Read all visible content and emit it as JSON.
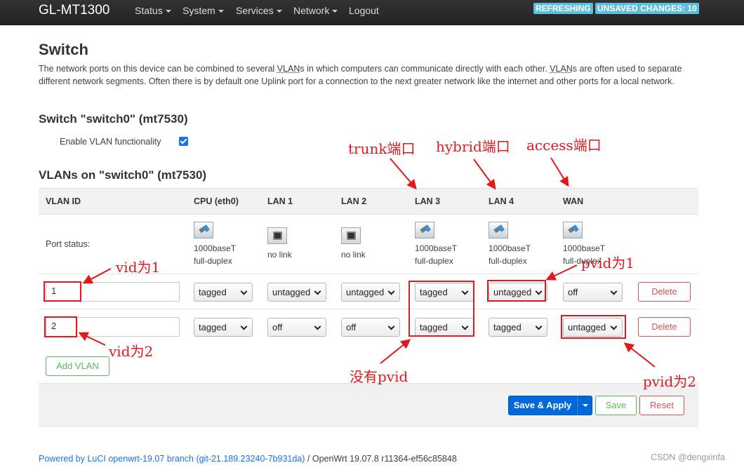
{
  "navbar": {
    "brand": "GL-MT1300",
    "menu": [
      {
        "label": "Status",
        "dropdown": true
      },
      {
        "label": "System",
        "dropdown": true
      },
      {
        "label": "Services",
        "dropdown": true
      },
      {
        "label": "Network",
        "dropdown": true
      },
      {
        "label": "Logout",
        "dropdown": false
      }
    ],
    "badges": {
      "refreshing": "REFRESHING",
      "unsaved": "UNSAVED CHANGES: 10"
    }
  },
  "page": {
    "title": "Switch",
    "desc_part1": "The network ports on this device can be combined to several ",
    "desc_vlans1": "VLAN",
    "desc_part2": "s in which computers can communicate directly with each other. ",
    "desc_vlans2": "VLAN",
    "desc_part3": "s are often used to separate different network segments. Often there is by default one Uplink port for a connection to the next greater network like the internet and other ports for a local network."
  },
  "switch_section": {
    "title": "Switch \"switch0\" (mt7530)",
    "vlan_toggle_label": "Enable VLAN functionality",
    "vlan_enabled": true
  },
  "vlans_section": {
    "title": "VLANs on \"switch0\" (mt7530)",
    "headers": [
      "VLAN ID",
      "CPU (eth0)",
      "LAN 1",
      "LAN 2",
      "LAN 3",
      "LAN 4",
      "WAN"
    ],
    "port_status_label": "Port status:",
    "ports": [
      {
        "icon": "ethernet-connected-icon",
        "line1": "1000baseT",
        "line2": "full-duplex"
      },
      {
        "icon": "ethernet-nolink-icon",
        "line1": "no link",
        "line2": ""
      },
      {
        "icon": "ethernet-nolink-icon",
        "line1": "no link",
        "line2": ""
      },
      {
        "icon": "ethernet-connected-icon",
        "line1": "1000baseT",
        "line2": "full-duplex"
      },
      {
        "icon": "ethernet-connected-icon",
        "line1": "1000baseT",
        "line2": "full-duplex"
      },
      {
        "icon": "ethernet-connected-icon",
        "line1": "1000baseT",
        "line2": "full-duplex"
      }
    ],
    "rows": [
      {
        "vid": "1",
        "cpu": "tagged",
        "lan1": "untagged",
        "lan2": "untagged",
        "lan3": "tagged",
        "lan4": "untagged",
        "wan": "off",
        "delete_label": "Delete"
      },
      {
        "vid": "2",
        "cpu": "tagged",
        "lan1": "off",
        "lan2": "off",
        "lan3": "tagged",
        "lan4": "tagged",
        "wan": "untagged",
        "delete_label": "Delete"
      }
    ],
    "add_label": "Add VLAN"
  },
  "actions": {
    "save_apply": "Save & Apply",
    "save": "Save",
    "reset": "Reset"
  },
  "footer": {
    "link_text": "Powered by LuCI openwrt-19.07 branch (git-21.189.23240-7b931da)",
    "separator": " / ",
    "version": "OpenWrt 19.07.8 r11364-ef56c85848"
  },
  "watermark": "CSDN @dengxinfa",
  "annotations": {
    "trunk": "trunk端口",
    "hybrid": "hybrid端口",
    "access": "access端口",
    "vid1": "vid为1",
    "vid2": "vid为2",
    "pvid1": "pvid为1",
    "pvid2": "pvid为2",
    "no_pvid": "没有pvid"
  },
  "colors": {
    "annotation": "#e0191c",
    "primary": "#0069d9",
    "success": "#5cb85c",
    "danger": "#d9534f",
    "badge": "#5bc0de"
  }
}
